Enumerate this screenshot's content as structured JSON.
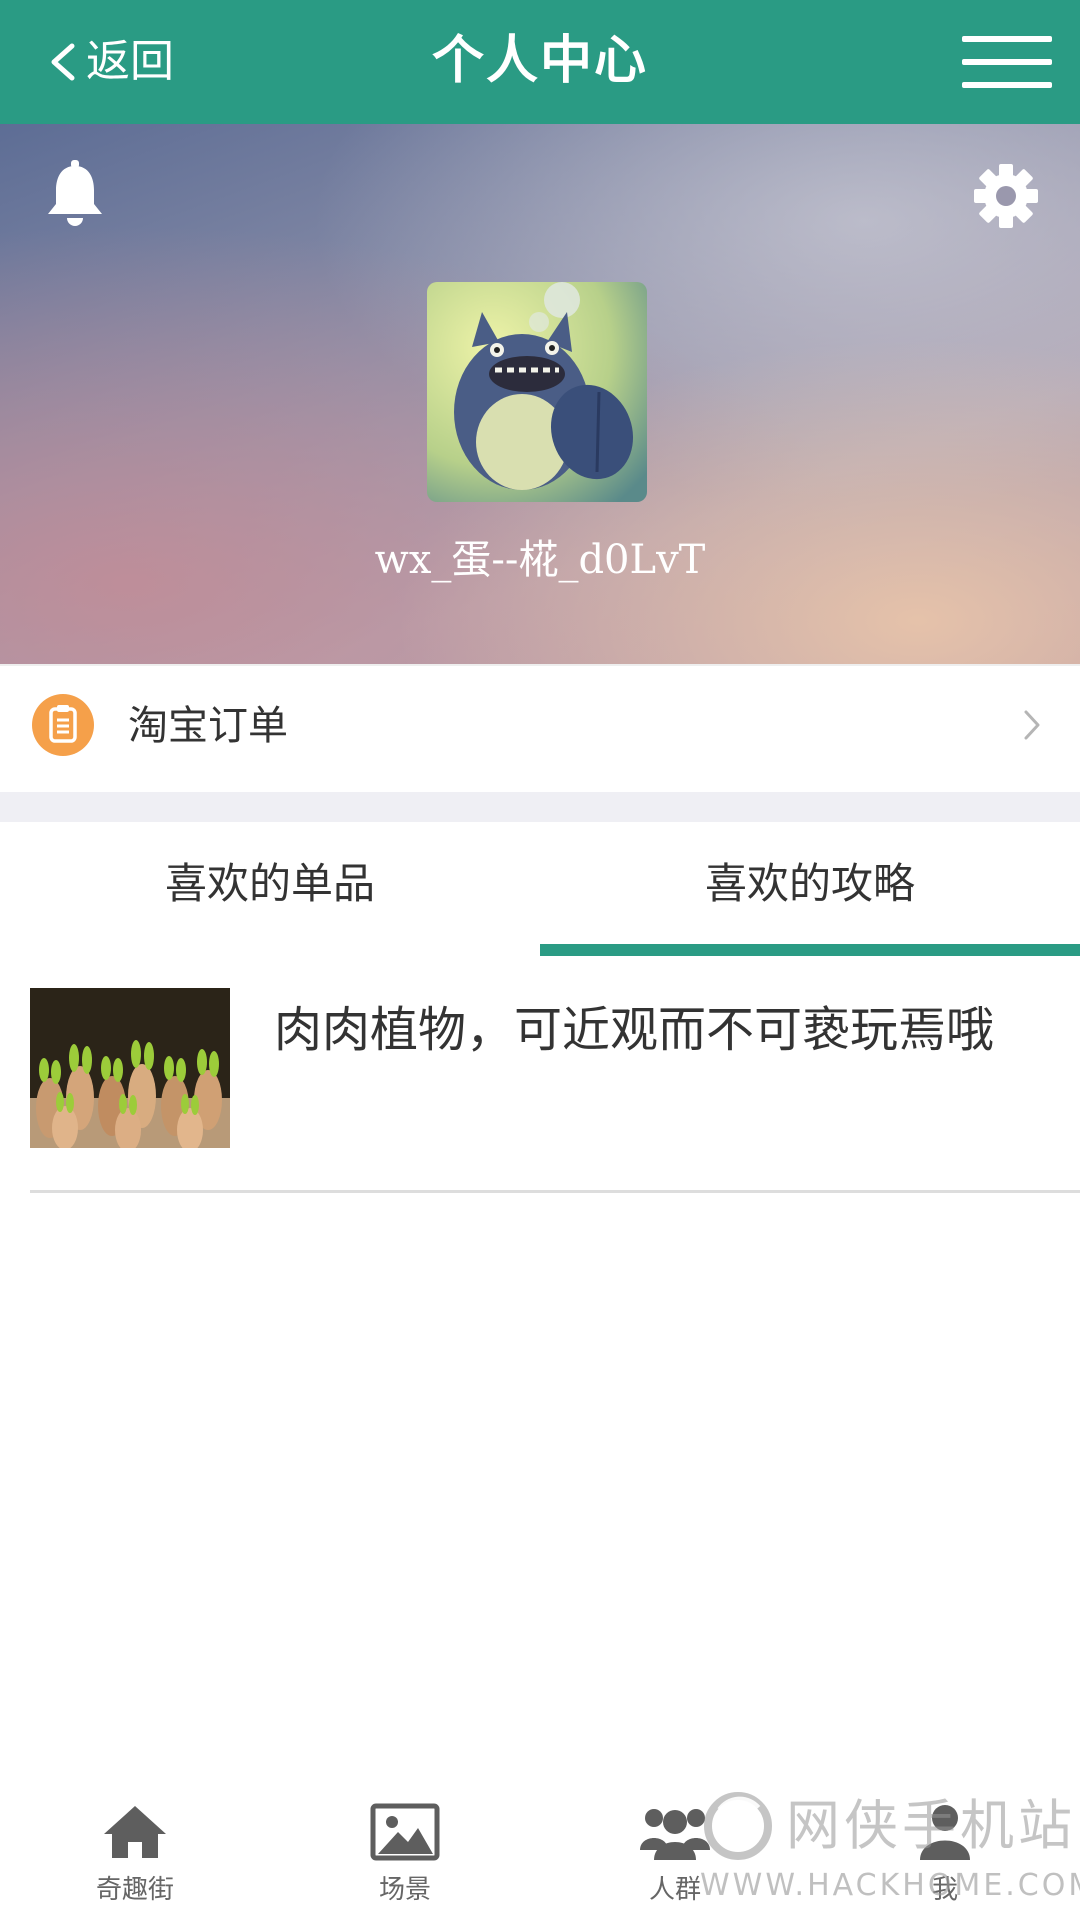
{
  "header": {
    "back_label": "返回",
    "title": "个人中心",
    "menu_icon": "hamburger-menu-icon"
  },
  "profile": {
    "bell_icon": "bell-icon",
    "settings_icon": "gear-icon",
    "avatar": "totoro-avatar",
    "username": "wx_蛋--椛_d0LvT"
  },
  "orders": {
    "label": "淘宝订单",
    "icon": "clipboard-icon",
    "chevron": "chevron-right-icon"
  },
  "tabs": [
    {
      "label": "喜欢的单品",
      "active": false
    },
    {
      "label": "喜欢的攻略",
      "active": true
    }
  ],
  "guides": [
    {
      "title": "肉肉植物，可近观而不可亵玩焉哦",
      "thumbnail": "succulent-plants-image"
    }
  ],
  "bottom_nav": [
    {
      "label": "奇趣街",
      "icon": "home-icon"
    },
    {
      "label": "场景",
      "icon": "image-icon"
    },
    {
      "label": "人群",
      "icon": "group-icon"
    },
    {
      "label": "我",
      "icon": "user-icon"
    }
  ],
  "watermark": {
    "cn": "网侠手机站",
    "en": "WWW.HACKHOME.COM"
  },
  "colors": {
    "brand_green": "#2a9b84",
    "order_icon_orange": "#f5a04a"
  }
}
